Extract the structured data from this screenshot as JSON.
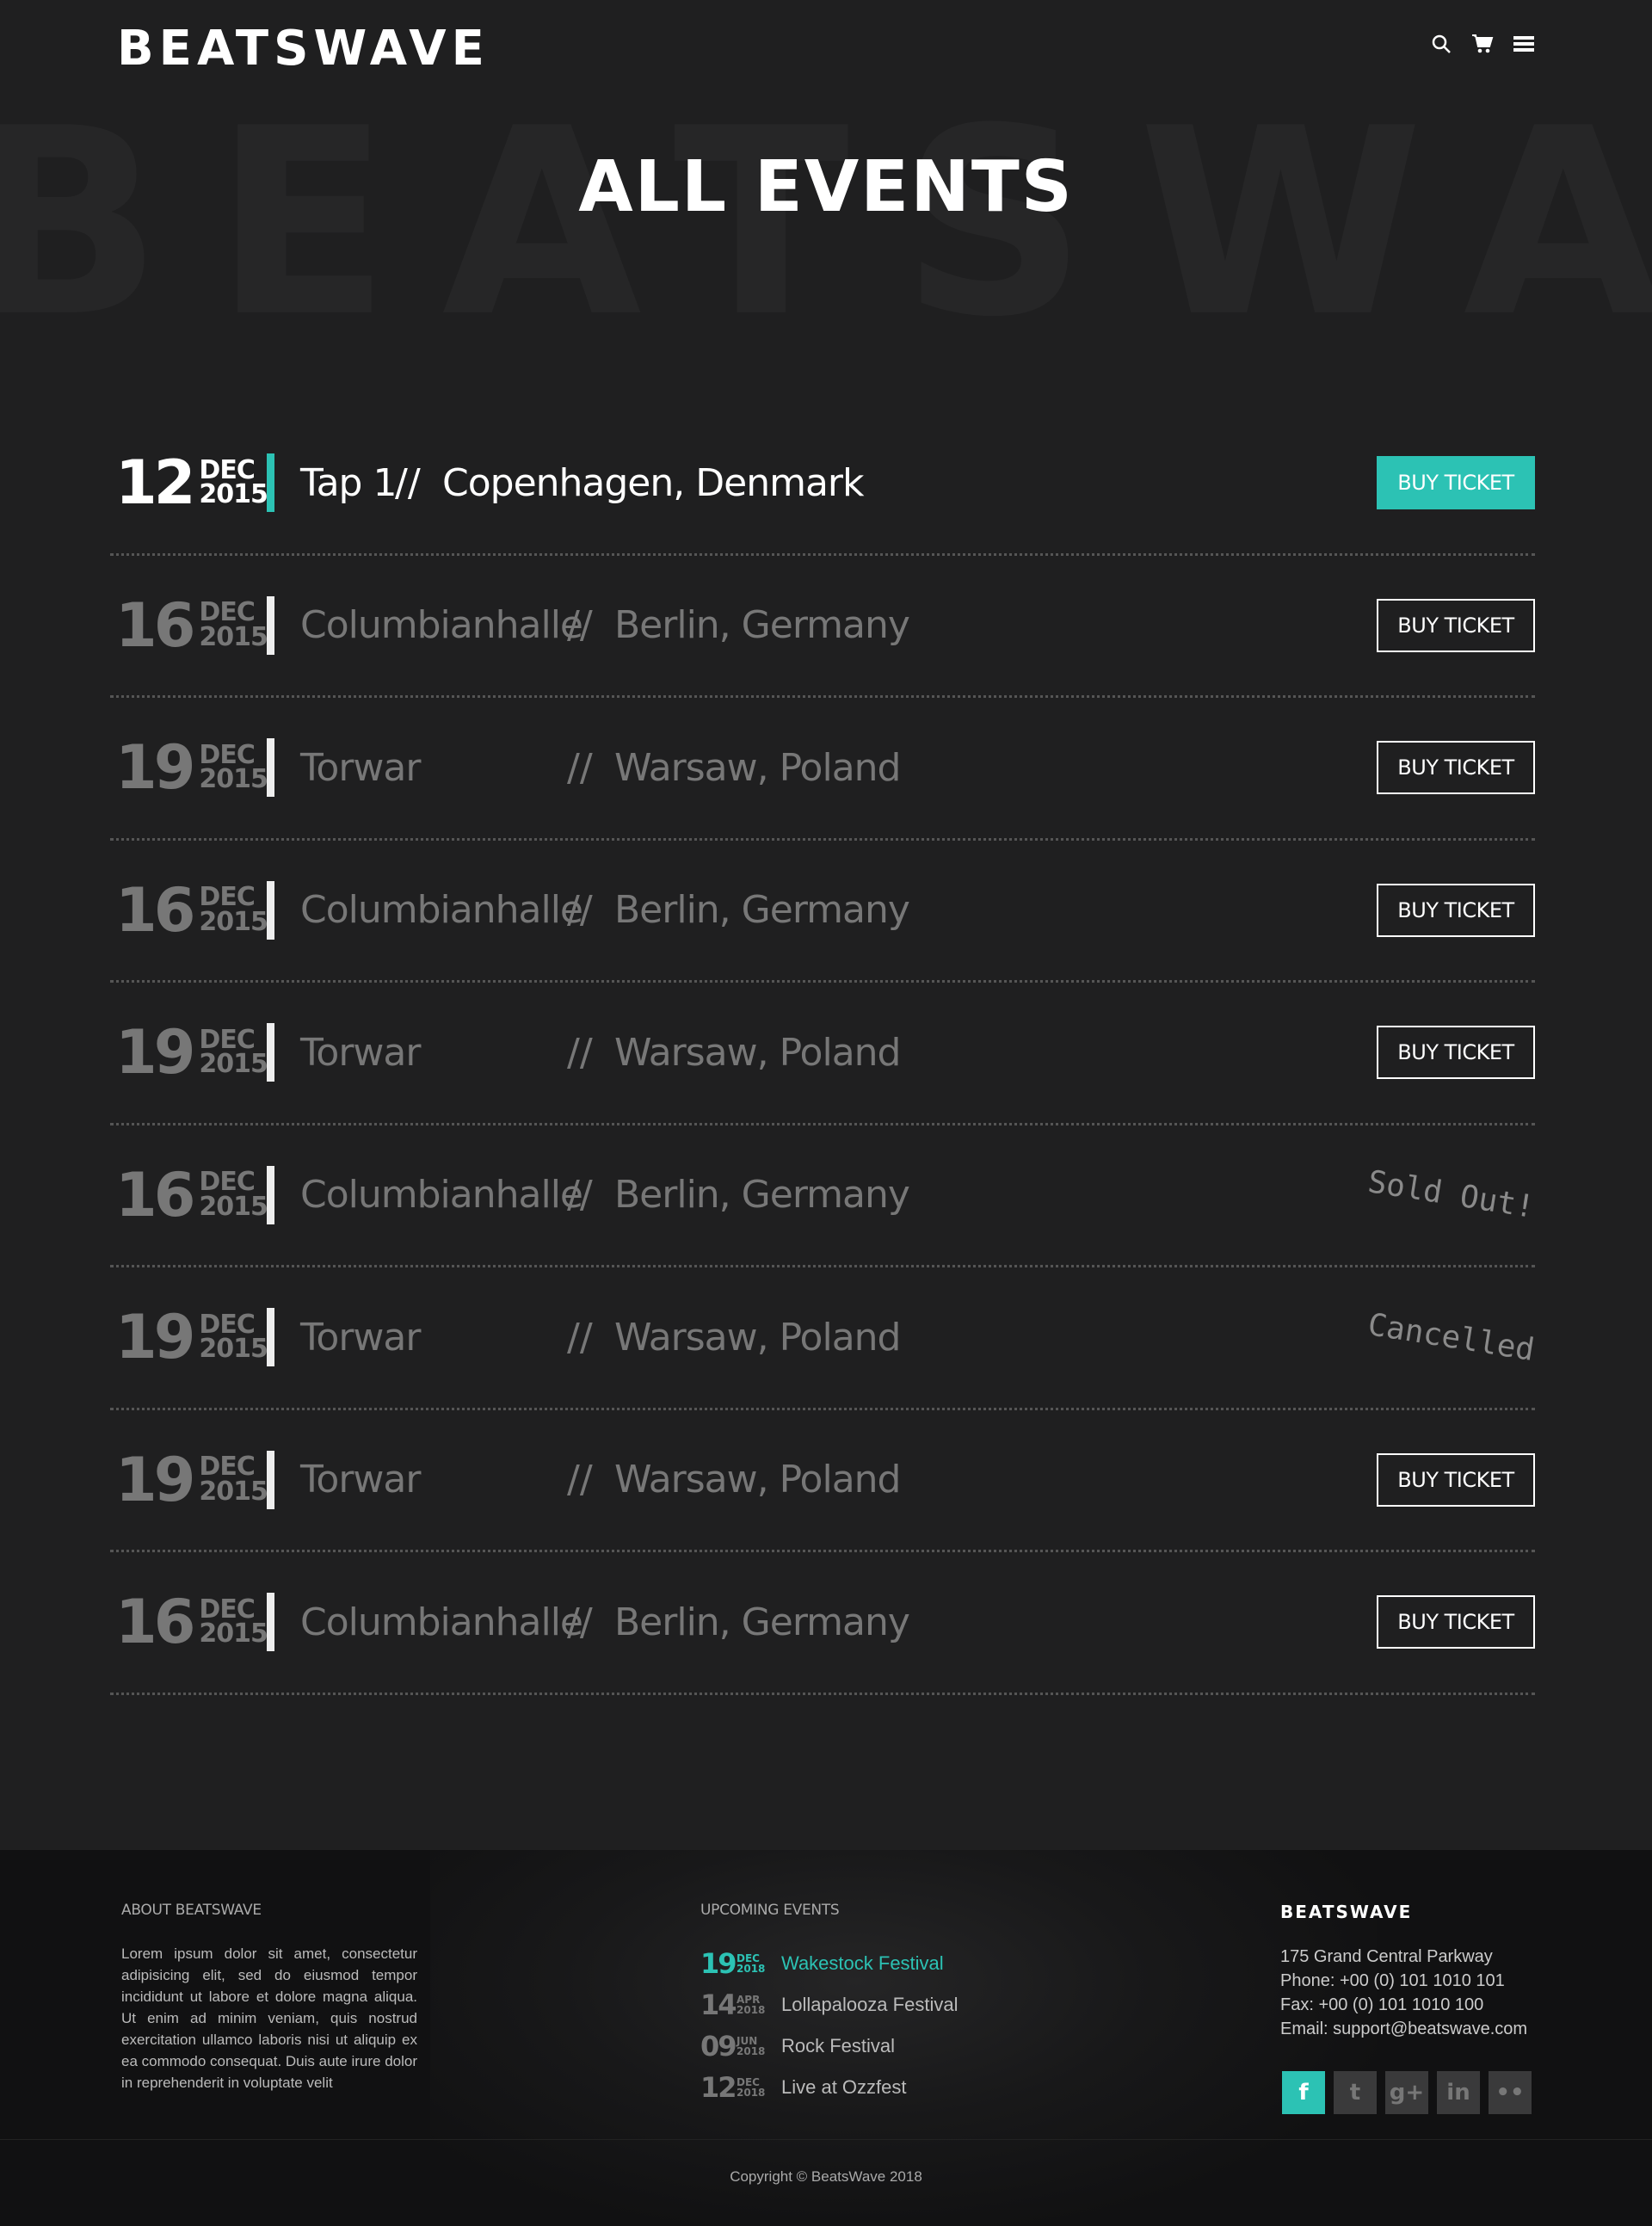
{
  "header": {
    "logo_text": "BEATSWAVE",
    "background_word": "BEATSWAVE",
    "title": "ALL EVENTS",
    "icons": [
      "search-icon",
      "cart-icon",
      "menu-icon"
    ]
  },
  "colors": {
    "accent": "#2cc2b4",
    "background": "#1f1f20",
    "footer": "#111112"
  },
  "events": [
    {
      "day": "12",
      "month": "DEC",
      "year": "2015",
      "venue": "Tap 1",
      "sep": "//",
      "location": "Copenhagen, Denmark",
      "action": "BUY TICKET",
      "status": "active"
    },
    {
      "day": "16",
      "month": "DEC",
      "year": "2015",
      "venue": "Columbianhalle",
      "sep": "//",
      "location": "Berlin, Germany",
      "action": "BUY TICKET",
      "status": "available"
    },
    {
      "day": "19",
      "month": "DEC",
      "year": "2015",
      "venue": "Torwar",
      "sep": "//",
      "location": "Warsaw, Poland",
      "action": "BUY TICKET",
      "status": "available"
    },
    {
      "day": "16",
      "month": "DEC",
      "year": "2015",
      "venue": "Columbianhalle",
      "sep": "//",
      "location": "Berlin, Germany",
      "action": "BUY TICKET",
      "status": "available"
    },
    {
      "day": "19",
      "month": "DEC",
      "year": "2015",
      "venue": "Torwar",
      "sep": "//",
      "location": "Warsaw, Poland",
      "action": "BUY TICKET",
      "status": "available"
    },
    {
      "day": "16",
      "month": "DEC",
      "year": "2015",
      "venue": "Columbianhalle",
      "sep": "//",
      "location": "Berlin, Germany",
      "action": "Sold Out!",
      "status": "sold-out"
    },
    {
      "day": "19",
      "month": "DEC",
      "year": "2015",
      "venue": "Torwar",
      "sep": "//",
      "location": "Warsaw, Poland",
      "action": "Cancelled",
      "status": "cancelled"
    },
    {
      "day": "19",
      "month": "DEC",
      "year": "2015",
      "venue": "Torwar",
      "sep": "//",
      "location": "Warsaw, Poland",
      "action": "BUY TICKET",
      "status": "available"
    },
    {
      "day": "16",
      "month": "DEC",
      "year": "2015",
      "venue": "Columbianhalle",
      "sep": "//",
      "location": "Berlin, Germany",
      "action": "BUY TICKET",
      "status": "available"
    }
  ],
  "footer": {
    "about": {
      "title": "ABOUT BEATSWAVE",
      "text": "Lorem ipsum dolor sit amet, consectetur adipisicing elit, sed do eiusmod tempor incididunt ut labore et dolore magna aliqua. Ut enim ad minim veniam, quis nostrud exercitation ullamco laboris nisi ut aliquip ex ea commodo consequat. Duis aute irure dolor in reprehenderit in voluptate velit"
    },
    "upcoming": {
      "title": "UPCOMING EVENTS",
      "items": [
        {
          "day": "19",
          "month": "DEC",
          "year": "2018",
          "name": "Wakestock Festival",
          "highlight": true
        },
        {
          "day": "14",
          "month": "APR",
          "year": "2018",
          "name": "Lollapalooza Festival",
          "highlight": false
        },
        {
          "day": "09",
          "month": "JUN",
          "year": "2018",
          "name": "Rock Festival",
          "highlight": false
        },
        {
          "day": "12",
          "month": "DEC",
          "year": "2018",
          "name": "Live at Ozzfest",
          "highlight": false
        }
      ]
    },
    "contact": {
      "logo_text": "BEATSWAVE",
      "address": "175 Grand Central Parkway",
      "phone": "Phone: +00 (0) 101 1010 101",
      "fax": "Fax: +00 (0) 101 1010 100",
      "email": "Email: support@beatswave.com"
    },
    "socials": [
      {
        "icon": "facebook-icon",
        "glyph": "f"
      },
      {
        "icon": "twitter-icon",
        "glyph": "t"
      },
      {
        "icon": "google-plus-icon",
        "glyph": "g+"
      },
      {
        "icon": "linkedin-icon",
        "glyph": "in"
      },
      {
        "icon": "flickr-icon",
        "glyph": "••"
      }
    ],
    "copyright": "Copyright © BeatsWave 2018"
  }
}
